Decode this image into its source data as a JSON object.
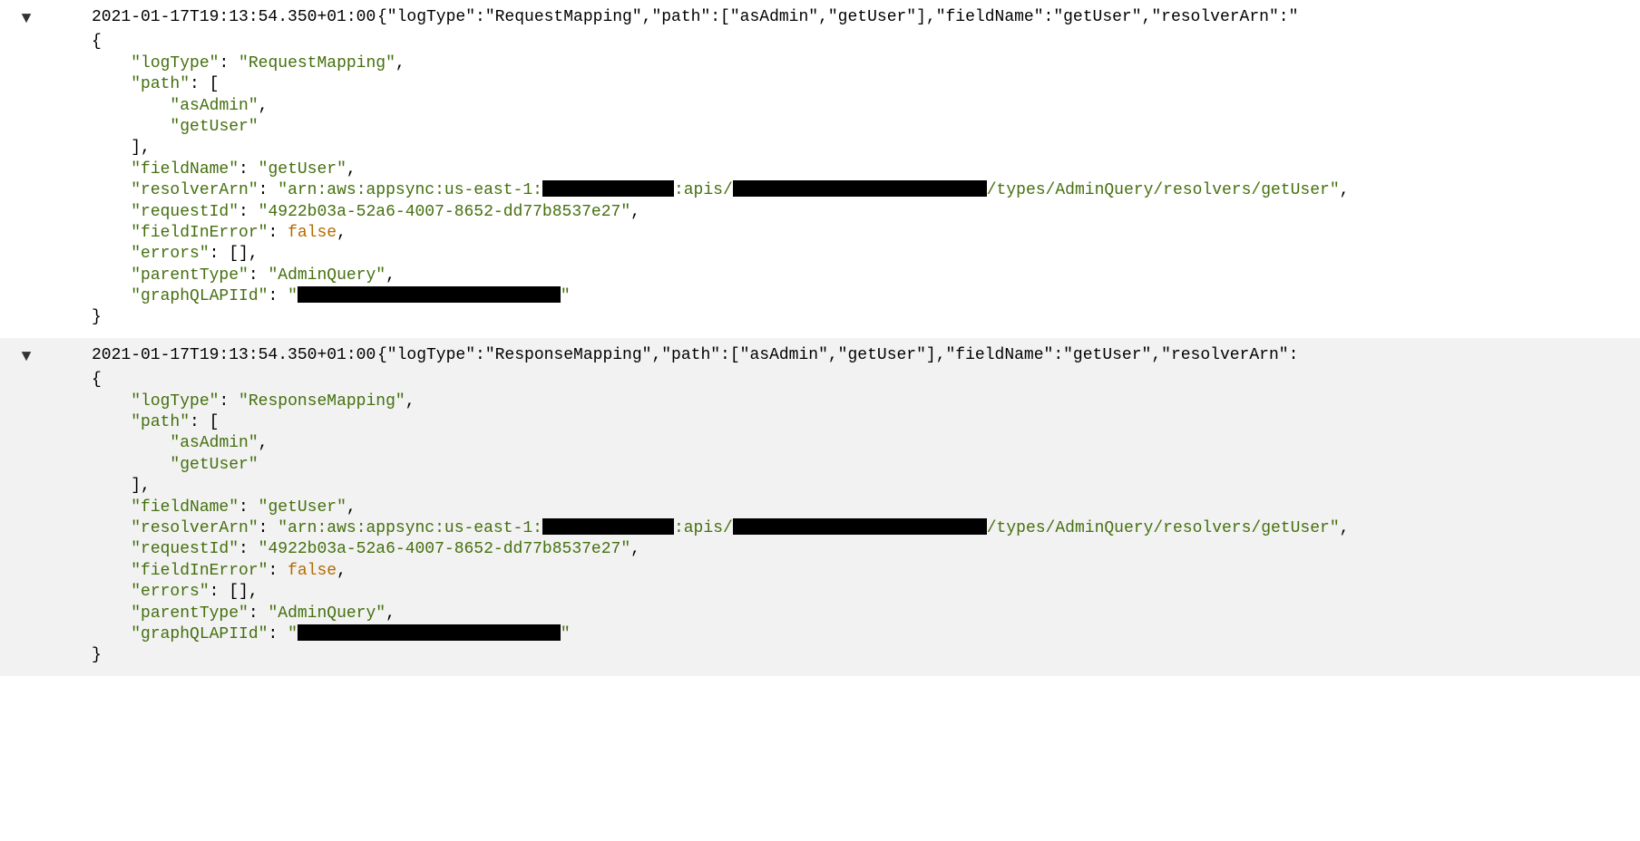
{
  "entries": [
    {
      "timestamp": "2021-01-17T19:13:54.350+01:00",
      "collapsed_preview": "{\"logType\":\"RequestMapping\",\"path\":[\"asAdmin\",\"getUser\"],\"fieldName\":\"getUser\",\"resolverArn\":\"",
      "json": {
        "logType": "RequestMapping",
        "path": [
          "asAdmin",
          "getUser"
        ],
        "fieldName": "getUser",
        "resolverArn_prefix": "arn:aws:appsync:us-east-1:",
        "resolverArn_mid": ":apis/",
        "resolverArn_suffix": "/types/AdminQuery/resolvers/getUser",
        "requestId": "4922b03a-52a6-4007-8652-dd77b8537e27",
        "fieldInError": "false",
        "errors_repr": "[]",
        "parentType": "AdminQuery",
        "graphQLAPIId_prefix": ""
      }
    },
    {
      "timestamp": "2021-01-17T19:13:54.350+01:00",
      "collapsed_preview": "{\"logType\":\"ResponseMapping\",\"path\":[\"asAdmin\",\"getUser\"],\"fieldName\":\"getUser\",\"resolverArn\":",
      "json": {
        "logType": "ResponseMapping",
        "path": [
          "asAdmin",
          "getUser"
        ],
        "fieldName": "getUser",
        "resolverArn_prefix": "arn:aws:appsync:us-east-1:",
        "resolverArn_mid": ":apis/",
        "resolverArn_suffix": "/types/AdminQuery/resolvers/getUser",
        "requestId": "4922b03a-52a6-4007-8652-dd77b8537e27",
        "fieldInError": "false",
        "errors_repr": "[]",
        "parentType": "AdminQuery",
        "graphQLAPIId_prefix": ""
      }
    }
  ]
}
